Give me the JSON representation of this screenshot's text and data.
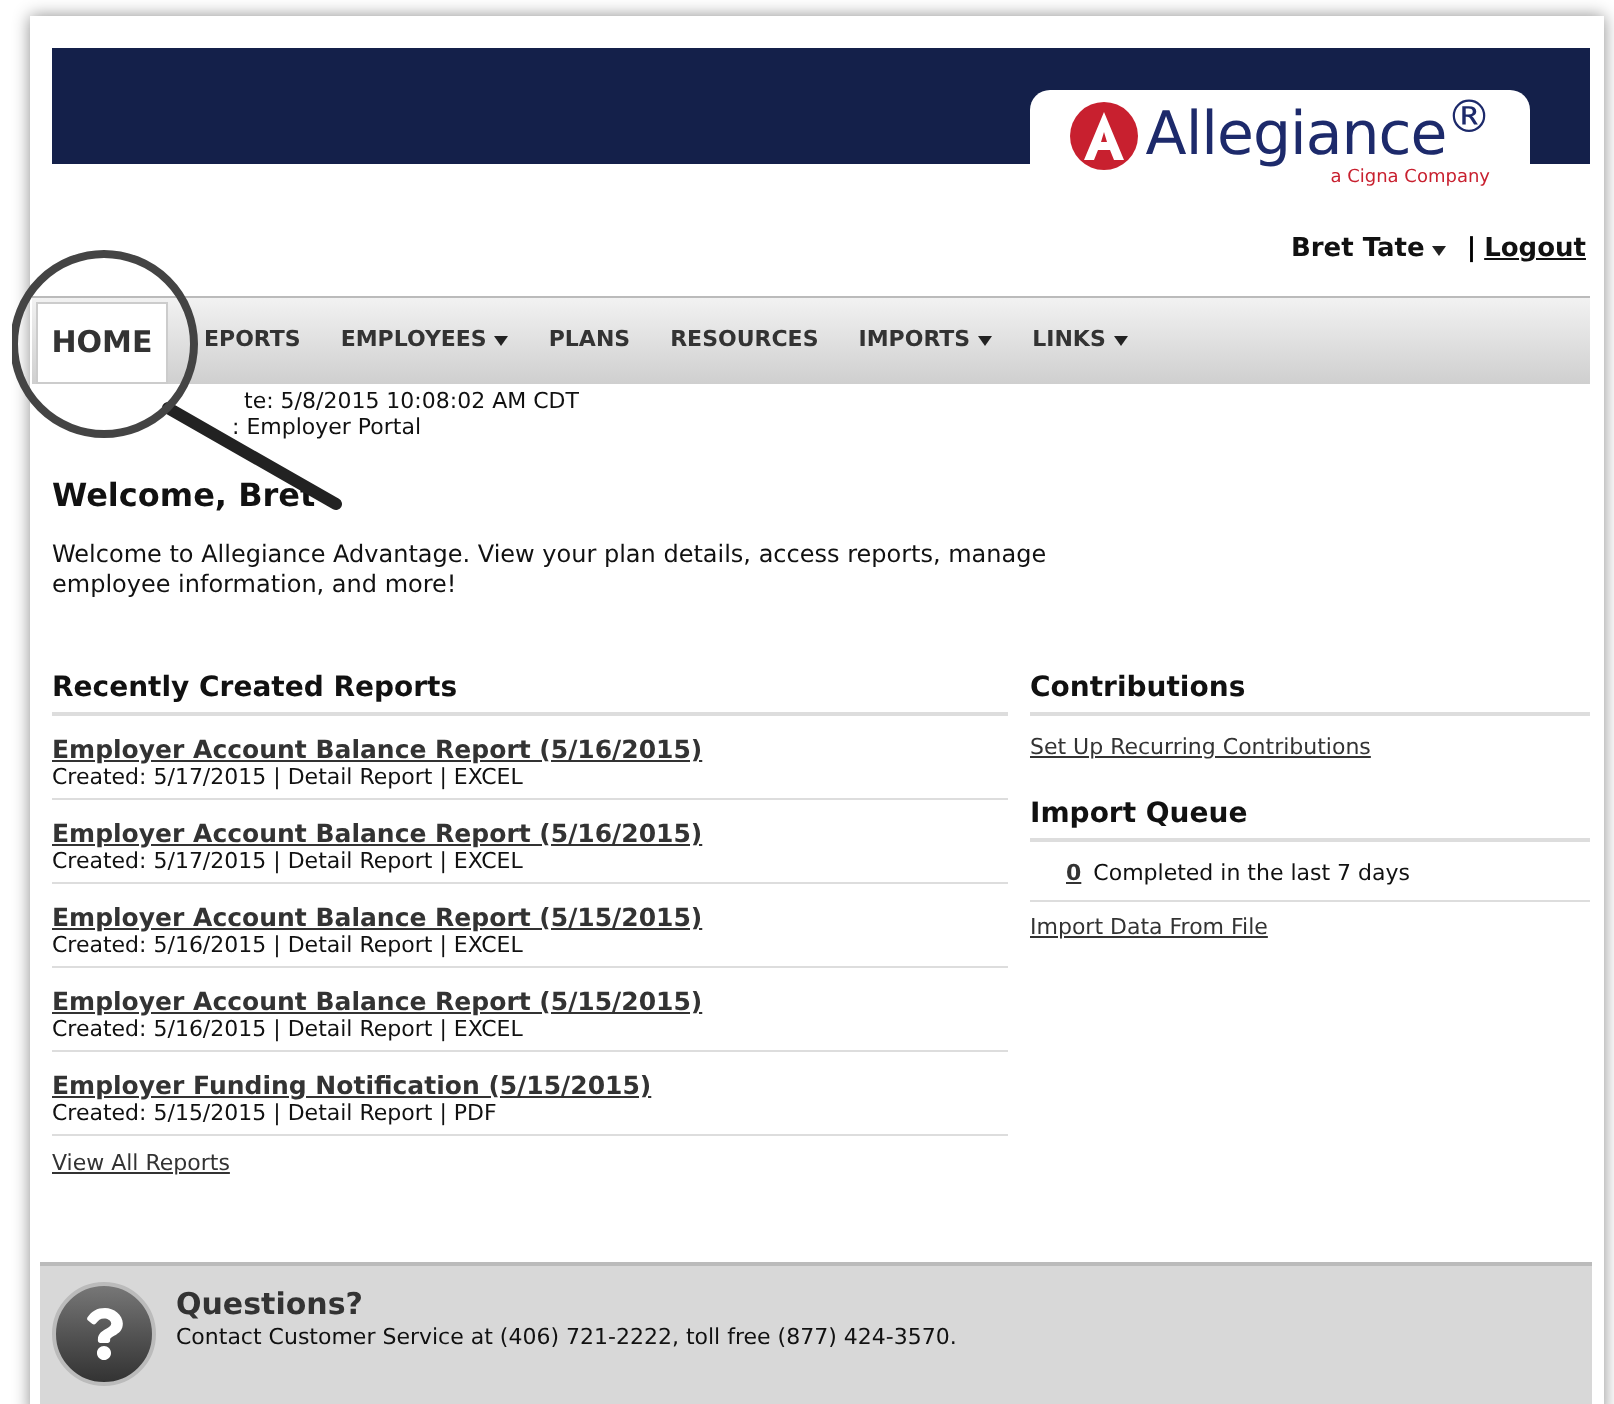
{
  "header": {
    "logo": {
      "name": "Allegiance$^{®}$",
      "tagline": "a Cigna Company"
    },
    "user": {
      "name": "Bret Tate",
      "dropdown": true,
      "separator": "|",
      "logout": "Logout"
    }
  },
  "nav": [
    {
      "label": "HOME",
      "selected": true,
      "dropdown": false
    },
    {
      "label": "EPORTS",
      "selected": false,
      "dropdown": false
    },
    {
      "label": "EMPLOYEES",
      "selected": false,
      "dropdown": true
    },
    {
      "label": "PLANS",
      "selected": false,
      "dropdown": false
    },
    {
      "label": "RESOURCES",
      "selected": false,
      "dropdown": false
    },
    {
      "label": "IMPORTS",
      "selected": false,
      "dropdown": true
    },
    {
      "label": "LINKS",
      "selected": false,
      "dropdown": true
    }
  ],
  "login_info": [
    "te: 5/8/2015 10:08:02 AM CDT",
    ": Employer Portal"
  ],
  "welcome": {
    "title": "Welcome, Bret",
    "text": "Welcome to Allegiance Advantage. View your plan details, access reports, manage employee information, and more!"
  },
  "reports": {
    "title": "Recently Created Reports",
    "items": [
      {
        "title": "Employer Account Balance Report (5/16/2015)",
        "meta": "Created: 5/17/2015 | Detail Report | EXCEL"
      },
      {
        "title": "Employer Account Balance Report (5/16/2015)",
        "meta": "Created: 5/17/2015 | Detail Report | EXCEL"
      },
      {
        "title": "Employer Account Balance Report (5/15/2015)",
        "meta": "Created: 5/16/2015 | Detail Report | EXCEL"
      },
      {
        "title": "Employer Account Balance Report (5/15/2015)",
        "meta": "Created: 5/16/2015 | Detail Report | EXCEL"
      },
      {
        "title": "Employer Funding Notification (5/15/2015)",
        "meta": "Created: 5/15/2015 | Detail Report | PDF"
      }
    ],
    "view_all": "View All Reports"
  },
  "contributions": {
    "title": "Contributions",
    "link": "Set Up Recurring Contributions"
  },
  "import_queue": {
    "title": "Import Queue",
    "count": "0",
    "text": "Completed in the last 7 days",
    "link": "Import Data From File"
  },
  "footer": {
    "title": "Questions?",
    "text": "Contact Customer Service at (406) 721-2222, toll free (877) 424-3570."
  }
}
